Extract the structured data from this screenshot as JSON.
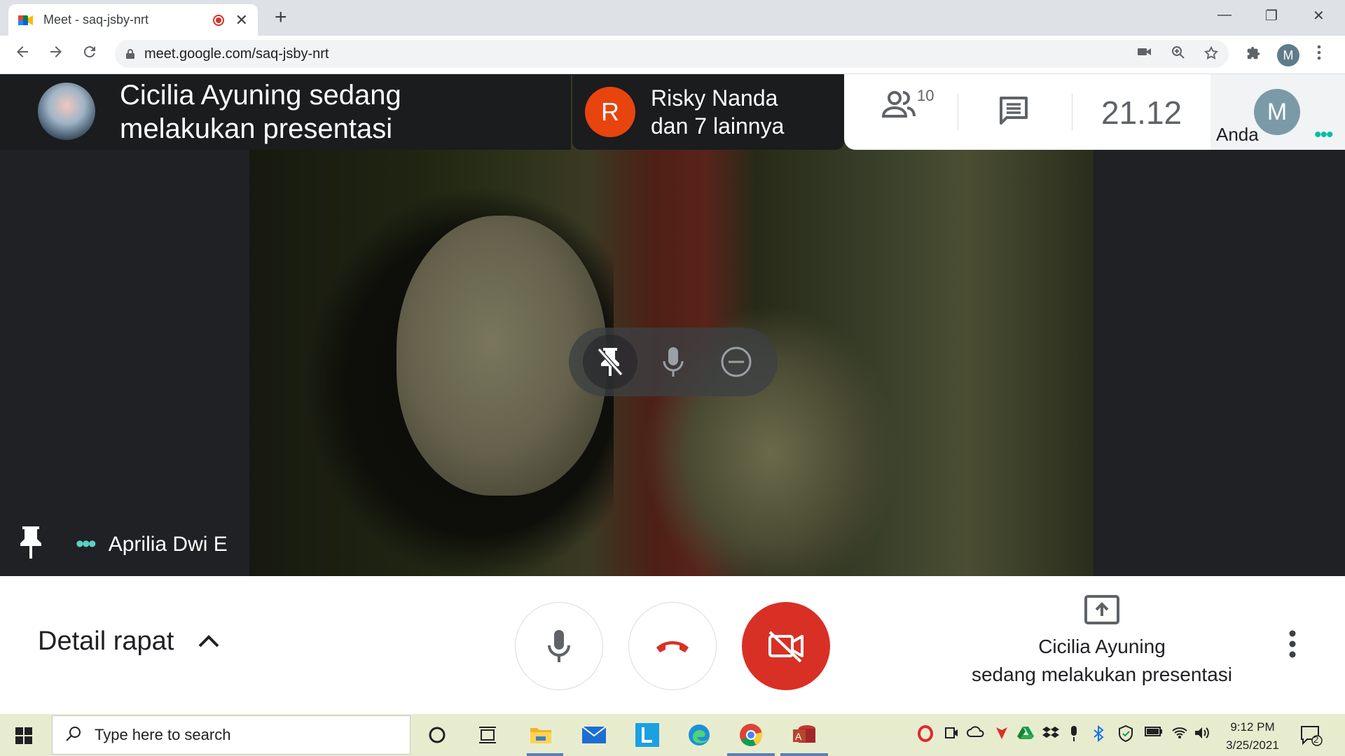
{
  "browser": {
    "tab_title": "Meet - saq-jsby-nrt",
    "tab_close": "✕",
    "new_tab": "+",
    "url": "meet.google.com/saq-jsby-nrt",
    "profile_initial": "M",
    "window_minimize": "—",
    "window_restore": "❐",
    "window_close": "✕"
  },
  "meet": {
    "presenter_banner": "Cicilia Ayuning sedang melakukan presentasi",
    "raised": {
      "initial": "R",
      "name": "Risky Nanda",
      "others": "dan 7 lainnya"
    },
    "participants_count": "10",
    "clock": "21.12",
    "self": {
      "initial": "M",
      "label": "Anda"
    },
    "tile": {
      "name": "Aprilia Dwi E"
    },
    "meeting_details": "Detail rapat",
    "presenting_line1": "Cicilia Ayuning",
    "presenting_line2": "sedang melakukan presentasi",
    "colors": {
      "red": "#d93025",
      "teal": "#00bfa5",
      "orange": "#e8440e"
    }
  },
  "taskbar": {
    "search_placeholder": "Type here to search",
    "time": "9:12 PM",
    "date": "3/25/2021",
    "notif_count": "2"
  }
}
